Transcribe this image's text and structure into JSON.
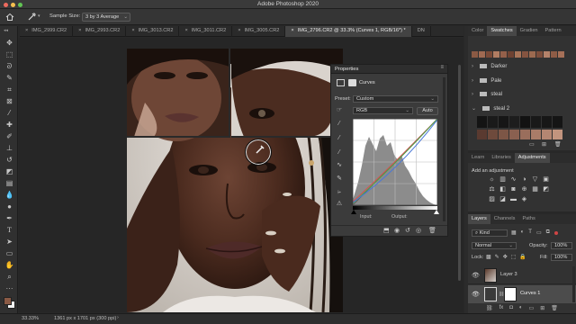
{
  "app": {
    "title": "Adobe Photoshop 2020",
    "traffic_colors": [
      "#ed6a5e",
      "#f5bf4f",
      "#61c554"
    ]
  },
  "options_bar": {
    "home_icon": "home-icon",
    "tool_icon": "eyedropper-icon",
    "sample_size_label": "Sample Size:",
    "sample_size_value": "3 by 3 Average"
  },
  "tabs": [
    {
      "label": "IMG_2999.CR2",
      "active": false
    },
    {
      "label": "IMG_2993.CR2",
      "active": false
    },
    {
      "label": "IMG_3013.CR2",
      "active": false
    },
    {
      "label": "IMG_3011.CR2",
      "active": false
    },
    {
      "label": "IMG_3005.CR2",
      "active": false
    },
    {
      "label": "IMG_2796.CR2 @ 33.3% (Curves 1, RGB/16*) *",
      "active": true
    },
    {
      "label": "DN",
      "active": false
    }
  ],
  "tab_close_glyph": "×",
  "status": {
    "zoom": "33.33%",
    "doc_info": "1361 px x 1701 px (300 ppi)"
  },
  "properties": {
    "title": "Properties",
    "panel_name": "Curves",
    "preset_label": "Preset:",
    "preset_value": "Custom",
    "channel_value": "RGB",
    "auto_label": "Auto",
    "input_label": "Input:",
    "output_label": "Output:"
  },
  "swatches_panel": {
    "tabs": [
      "Color",
      "Swatches",
      "Gradien",
      "Pattern"
    ],
    "active_tab": "Swatches",
    "top_swatches": [
      "#8b5a44",
      "#a06a52",
      "#7a4a38",
      "#b07c62",
      "#94604a",
      "#6e4232",
      "#a87458",
      "#855440",
      "#9c6a50",
      "#7c4e3c",
      "#b4826a",
      "#8e5c46",
      "#a67058"
    ],
    "groups": [
      {
        "label": "Darker"
      },
      {
        "label": "Pale"
      },
      {
        "label": "steal"
      },
      {
        "label": "steal 2"
      }
    ],
    "grid_top": [
      "#141414",
      "#1a1a1a",
      "#161616",
      "#1d1d1d",
      "#121212",
      "#191919",
      "#171717",
      "#151515"
    ],
    "grid_bottom": [
      "#5a3a30",
      "#6e4a3c",
      "#7d5646",
      "#8a6050",
      "#9a6e5c",
      "#a97c68",
      "#b48672",
      "#c2947e"
    ]
  },
  "adjustments_panel": {
    "tabs": [
      "Learn",
      "Libraries",
      "Adjustments"
    ],
    "active_tab": "Adjustments",
    "add_label": "Add an adjustment",
    "icon_names": [
      "brightness-icon",
      "levels-icon",
      "curves-icon",
      "exposure-icon",
      "vibrance-icon",
      "hue-saturation-icon",
      "color-balance-icon",
      "black-white-icon",
      "photo-filter-icon",
      "channel-mixer-icon",
      "color-lookup-icon",
      "invert-icon",
      "posterize-icon",
      "threshold-icon",
      "gradient-map-icon",
      "selective-color-icon"
    ]
  },
  "layers_panel": {
    "tabs": [
      "Layers",
      "Channels",
      "Paths"
    ],
    "active_tab": "Layers",
    "kind_value": "Kind",
    "blend_value": "Normal",
    "opacity_label": "Opacity:",
    "opacity_value": "100%",
    "lock_label": "Lock:",
    "fill_label": "Fill:",
    "fill_value": "100%",
    "layers": [
      {
        "name": "Layer 3",
        "selected": false
      },
      {
        "name": "Curves 1",
        "selected": true
      }
    ]
  }
}
